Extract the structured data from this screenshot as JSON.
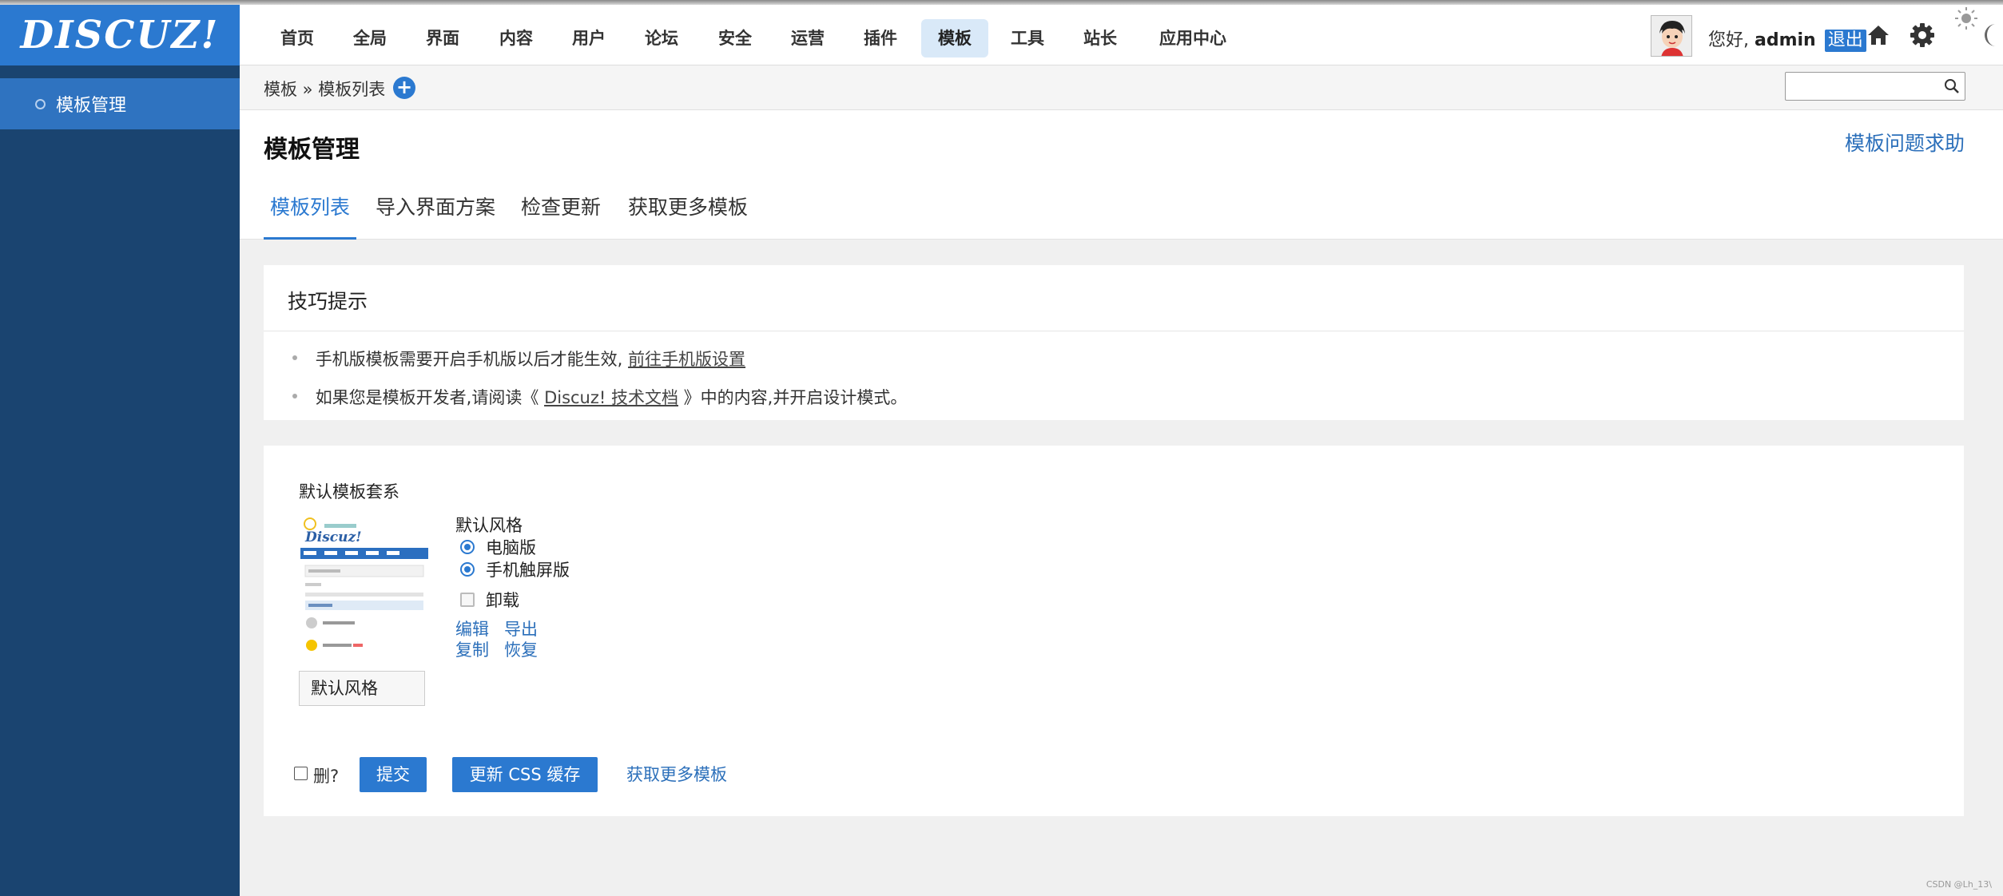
{
  "brand": {
    "logo_text": "DISCUZ!"
  },
  "sidebar": {
    "items": [
      {
        "label": "模板管理"
      }
    ]
  },
  "topnav": {
    "items": [
      {
        "label": "首页"
      },
      {
        "label": "全局"
      },
      {
        "label": "界面"
      },
      {
        "label": "内容"
      },
      {
        "label": "用户"
      },
      {
        "label": "论坛"
      },
      {
        "label": "安全"
      },
      {
        "label": "运营"
      },
      {
        "label": "插件"
      },
      {
        "label": "模板",
        "active": true
      },
      {
        "label": "工具"
      },
      {
        "label": "站长"
      },
      {
        "label": "应用中心"
      }
    ],
    "greeting": "您好,",
    "username": "admin",
    "logout": "退出"
  },
  "breadcrumb": {
    "text": "模板 » 模板列表",
    "add_symbol": "+"
  },
  "search": {
    "placeholder": ""
  },
  "page": {
    "title": "模板管理",
    "help_link": "模板问题求助",
    "tabs": [
      {
        "label": "模板列表",
        "active": true
      },
      {
        "label": "导入界面方案"
      },
      {
        "label": "检查更新"
      },
      {
        "label": "获取更多模板"
      }
    ]
  },
  "tips": {
    "title": "技巧提示",
    "line1_text": "手机版模板需要开启手机版以后才能生效,",
    "line1_link": "前往手机版设置",
    "line2_prefix": "如果您是模板开发者,请阅读《",
    "line2_link": "Discuz! 技术文档",
    "line2_suffix": "》中的内容,并开启设计模式。"
  },
  "template": {
    "set_title": "默认模板套系",
    "style_label": "默认风格",
    "options": [
      {
        "label": "电脑版",
        "checked": true
      },
      {
        "label": "手机触屏版",
        "checked": true
      },
      {
        "label": "卸载",
        "checked": false
      }
    ],
    "actions": {
      "edit": "编辑",
      "export": "导出",
      "copy": "复制",
      "restore": "恢复"
    },
    "style_name_value": "默认风格"
  },
  "footer": {
    "delete_label": "删?",
    "submit": "提交",
    "update_css": "更新 CSS 缓存",
    "more_templates": "获取更多模板"
  },
  "watermark": "CSDN @Lh_13\\",
  "colors": {
    "accent": "#2b79d0",
    "sidebar_bg": "#1a4470",
    "sidebar_active": "#2f73c0"
  }
}
